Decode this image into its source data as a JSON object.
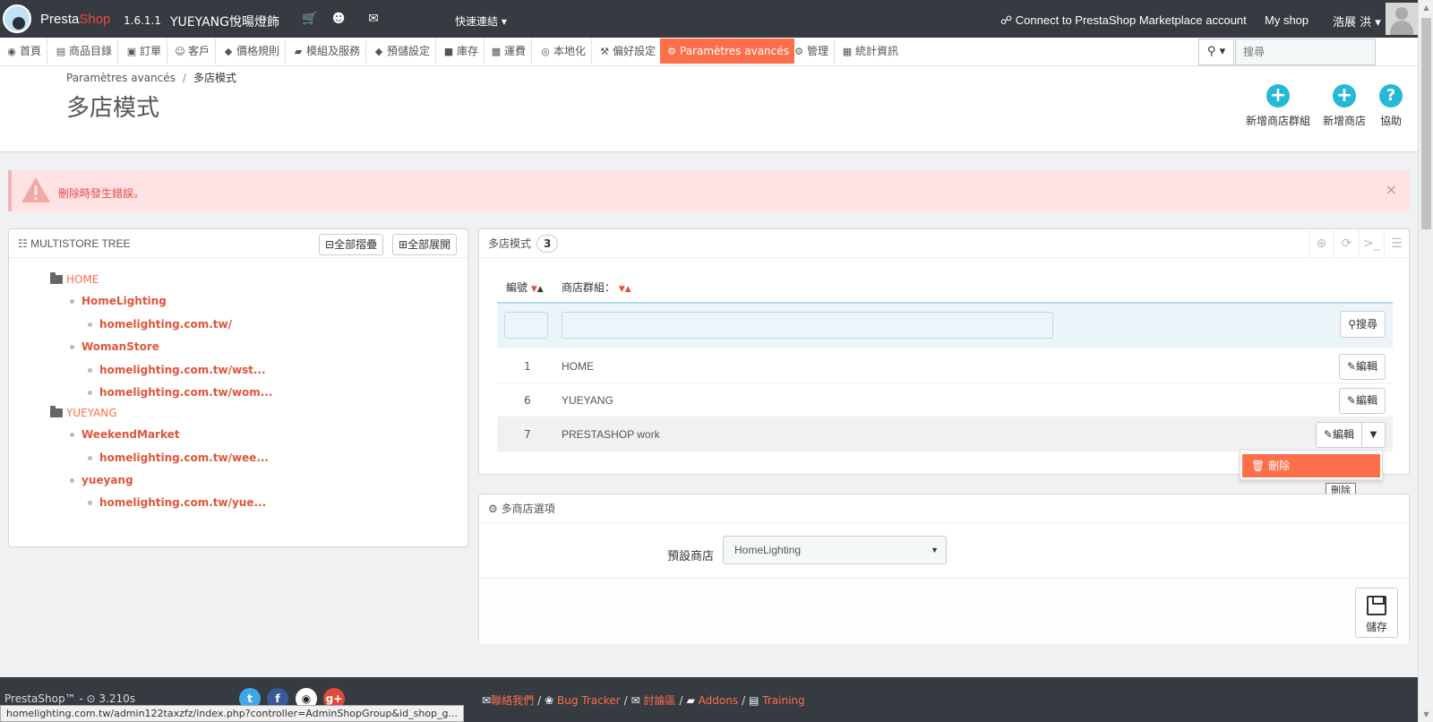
{
  "topbar": {
    "brand_presta": "Presta",
    "brand_shop": "Shop",
    "version": "1.6.1.1",
    "shop_name": "YUEYANG悅暘燈飾",
    "quick_access": "快速連結",
    "connect": "Connect to PrestaShop Marketplace account",
    "my_shop": "My shop",
    "user": "浩展 洪"
  },
  "nav": {
    "items": [
      {
        "icon": "dashboard-icon",
        "label": "首頁"
      },
      {
        "icon": "book-icon",
        "label": "商品目錄"
      },
      {
        "icon": "credit-card-icon",
        "label": "訂單"
      },
      {
        "icon": "users-icon",
        "label": "客戶"
      },
      {
        "icon": "tag-icon",
        "label": "價格規則"
      },
      {
        "icon": "puzzle-icon",
        "label": "模組及服務"
      },
      {
        "icon": "tags-icon",
        "label": "預儲設定"
      },
      {
        "icon": "archive-icon",
        "label": "庫存"
      },
      {
        "icon": "truck-icon",
        "label": "運費"
      },
      {
        "icon": "globe-icon",
        "label": "本地化"
      },
      {
        "icon": "wrench-icon",
        "label": "偏好設定"
      },
      {
        "icon": "cogs-icon",
        "label": "Paramètres avancés"
      },
      {
        "icon": "cog-icon",
        "label": "管理"
      },
      {
        "icon": "bar-chart-icon",
        "label": "統計資訊"
      }
    ],
    "search_placeholder": "搜尋"
  },
  "header": {
    "breadcrumb_parent": "Paramètres avancés",
    "breadcrumb_sep": "/",
    "breadcrumb_current": "多店模式",
    "title": "多店模式",
    "toolbar": {
      "add_group": "新增商店群組",
      "add_shop": "新增商店",
      "help": "協助"
    }
  },
  "alert": {
    "message": "刪除時發生錯誤。",
    "close": "×"
  },
  "tree": {
    "title": "MULTISTORE TREE",
    "collapse_all": "全部摺疊",
    "expand_all": "全部展開",
    "group1": "HOME",
    "shop1": "HomeLighting",
    "url1": "homelighting.com.tw/",
    "shop2": "WomanStore",
    "url2a": "homelighting.com.tw/wst...",
    "url2b": "homelighting.com.tw/wom...",
    "group2": "YUEYANG",
    "shop3": "WeekendMarket",
    "url3": "homelighting.com.tw/wee...",
    "shop4": "yueyang",
    "url4": "homelighting.com.tw/yue..."
  },
  "list": {
    "title": "多店模式",
    "count": "3",
    "col_id": "編號",
    "col_group": "商店群組：",
    "search": "搜尋",
    "edit": "編輯",
    "rows": [
      {
        "id": "1",
        "name": "HOME"
      },
      {
        "id": "6",
        "name": "YUEYANG"
      },
      {
        "id": "7",
        "name": "PRESTASHOP work"
      }
    ],
    "dropdown_delete": "刪除",
    "tooltip": "刪除"
  },
  "options": {
    "title": "多商店選項",
    "default_shop_label": "預設商店",
    "default_shop_value": "HomeLighting",
    "save": "儲存"
  },
  "footer": {
    "ps": "PrestaShop™ - ⊙ 3.210s",
    "contact": "聯絡我們",
    "bug": "Bug Tracker",
    "forum": "討論區",
    "addons": "Addons",
    "training": "Training"
  },
  "statusbar": "homelighting.com.tw/admin122taxzfz/index.php?controller=AdminShopGroup&id_shop_g...",
  "colors": {
    "accent": "#fd6f4a",
    "topbar": "#363a41",
    "info": "#25b9d7",
    "danger_bg": "#ffe2e4"
  }
}
